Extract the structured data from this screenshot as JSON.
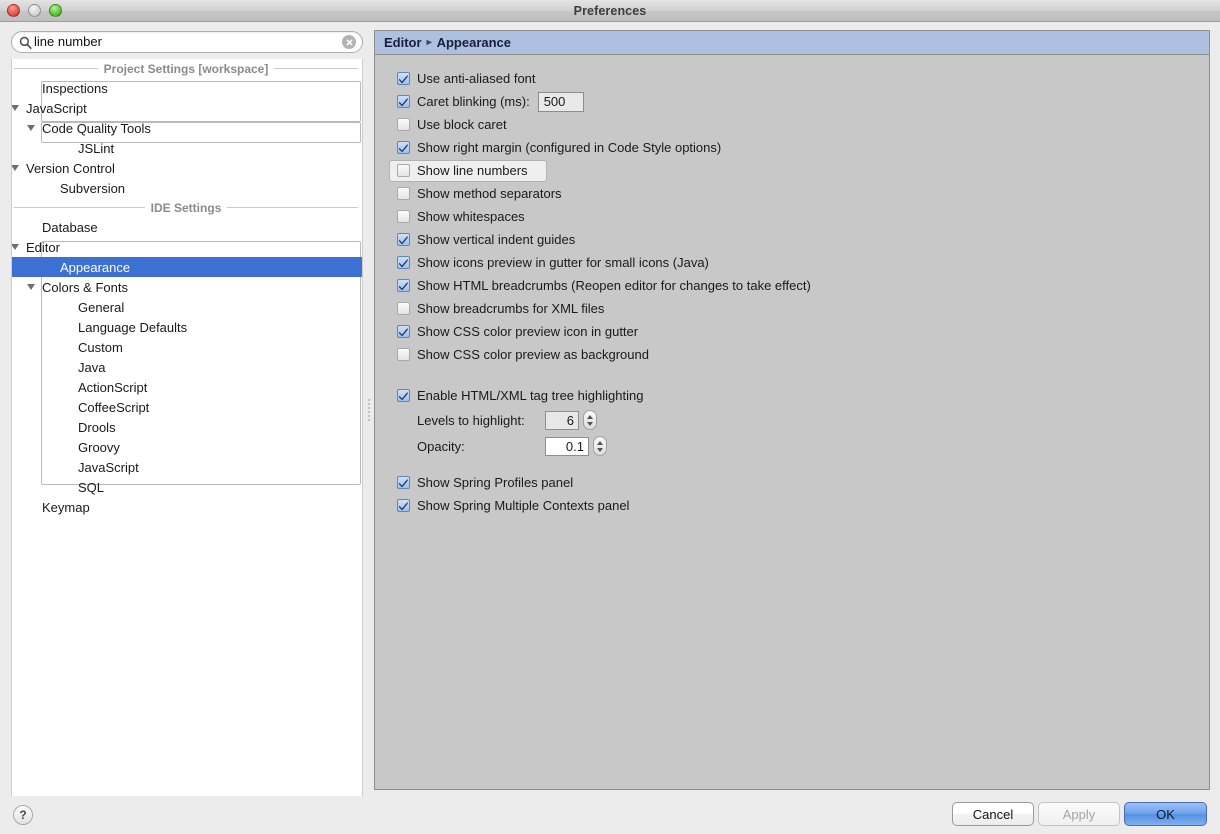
{
  "window": {
    "title": "Preferences",
    "traffic_lights": [
      "close-button",
      "minimize-button",
      "zoom-button"
    ]
  },
  "search": {
    "value": "line number",
    "placeholder": "Search",
    "icon": "search-icon",
    "clear_icon": "clear-icon"
  },
  "sidebar": {
    "groups": [
      {
        "header": "Project Settings [workspace]",
        "items": [
          {
            "label": "Inspections",
            "indent": 1,
            "twisty": false,
            "selected": false,
            "matched": false
          },
          {
            "label": "JavaScript",
            "indent": 0,
            "twisty": true,
            "selected": false,
            "matched": false
          },
          {
            "label": "Code Quality Tools",
            "indent": 1,
            "twisty": true,
            "selected": false,
            "matched": true
          },
          {
            "label": "JSLint",
            "indent": 3,
            "twisty": false,
            "selected": false,
            "matched": true
          },
          {
            "label": "Version Control",
            "indent": 0,
            "twisty": true,
            "selected": false,
            "matched": false
          },
          {
            "label": "Subversion",
            "indent": 2,
            "twisty": false,
            "selected": false,
            "matched": true
          }
        ]
      },
      {
        "header": "IDE Settings",
        "items": [
          {
            "label": "Database",
            "indent": 1,
            "twisty": false,
            "selected": false,
            "matched": false
          },
          {
            "label": "Editor",
            "indent": 0,
            "twisty": true,
            "selected": false,
            "matched": false
          },
          {
            "label": "Appearance",
            "indent": 2,
            "twisty": false,
            "selected": true,
            "matched": true
          },
          {
            "label": "Colors & Fonts",
            "indent": 1,
            "twisty": true,
            "selected": false,
            "matched": true
          },
          {
            "label": "General",
            "indent": 3,
            "twisty": false,
            "selected": false,
            "matched": true
          },
          {
            "label": "Language Defaults",
            "indent": 3,
            "twisty": false,
            "selected": false,
            "matched": true
          },
          {
            "label": "Custom",
            "indent": 3,
            "twisty": false,
            "selected": false,
            "matched": true
          },
          {
            "label": "Java",
            "indent": 3,
            "twisty": false,
            "selected": false,
            "matched": true
          },
          {
            "label": "ActionScript",
            "indent": 3,
            "twisty": false,
            "selected": false,
            "matched": true
          },
          {
            "label": "CoffeeScript",
            "indent": 3,
            "twisty": false,
            "selected": false,
            "matched": true
          },
          {
            "label": "Drools",
            "indent": 3,
            "twisty": false,
            "selected": false,
            "matched": true
          },
          {
            "label": "Groovy",
            "indent": 3,
            "twisty": false,
            "selected": false,
            "matched": true
          },
          {
            "label": "JavaScript",
            "indent": 3,
            "twisty": false,
            "selected": false,
            "matched": true
          },
          {
            "label": "SQL",
            "indent": 3,
            "twisty": false,
            "selected": false,
            "matched": true
          },
          {
            "label": "Keymap",
            "indent": 1,
            "twisty": false,
            "selected": false,
            "matched": false
          }
        ]
      }
    ]
  },
  "panel": {
    "breadcrumb_root": "Editor",
    "breadcrumb_leaf": "Appearance",
    "breadcrumb_separator": "▸",
    "header_color": "#adc0e0",
    "options": [
      {
        "label": "Use anti-aliased font",
        "checked": true,
        "highlighted": false
      },
      {
        "label": "Caret blinking (ms):",
        "checked": true,
        "highlighted": false,
        "field": "500"
      },
      {
        "label": "Use block caret",
        "checked": false,
        "highlighted": false
      },
      {
        "label": "Show right margin (configured in Code Style options)",
        "checked": true,
        "highlighted": false
      },
      {
        "label": "Show line numbers",
        "checked": false,
        "highlighted": true
      },
      {
        "label": "Show method separators",
        "checked": false,
        "highlighted": false
      },
      {
        "label": "Show whitespaces",
        "checked": false,
        "highlighted": false
      },
      {
        "label": "Show vertical indent guides",
        "checked": true,
        "highlighted": false
      },
      {
        "label": "Show icons preview in gutter for small icons (Java)",
        "checked": true,
        "highlighted": false
      },
      {
        "label": "Show HTML breadcrumbs (Reopen editor for changes to take effect)",
        "checked": true,
        "highlighted": false
      },
      {
        "label": "Show breadcrumbs for XML files",
        "checked": false,
        "highlighted": false
      },
      {
        "label": "Show CSS color preview icon in gutter",
        "checked": true,
        "highlighted": false
      },
      {
        "label": "Show CSS color preview as background",
        "checked": false,
        "highlighted": false
      }
    ],
    "tag_tree": {
      "label": "Enable HTML/XML tag tree highlighting",
      "checked": true,
      "levels_label": "Levels to highlight:",
      "levels_value": "6",
      "opacity_label": "Opacity:",
      "opacity_value": "0.1"
    },
    "spring_options": [
      {
        "label": "Show Spring Profiles panel",
        "checked": true
      },
      {
        "label": "Show Spring Multiple Contexts panel",
        "checked": true
      }
    ]
  },
  "footer": {
    "help_label": "?",
    "cancel_label": "Cancel",
    "apply_label": "Apply",
    "ok_label": "OK",
    "ok_accent": "#5590e4"
  }
}
